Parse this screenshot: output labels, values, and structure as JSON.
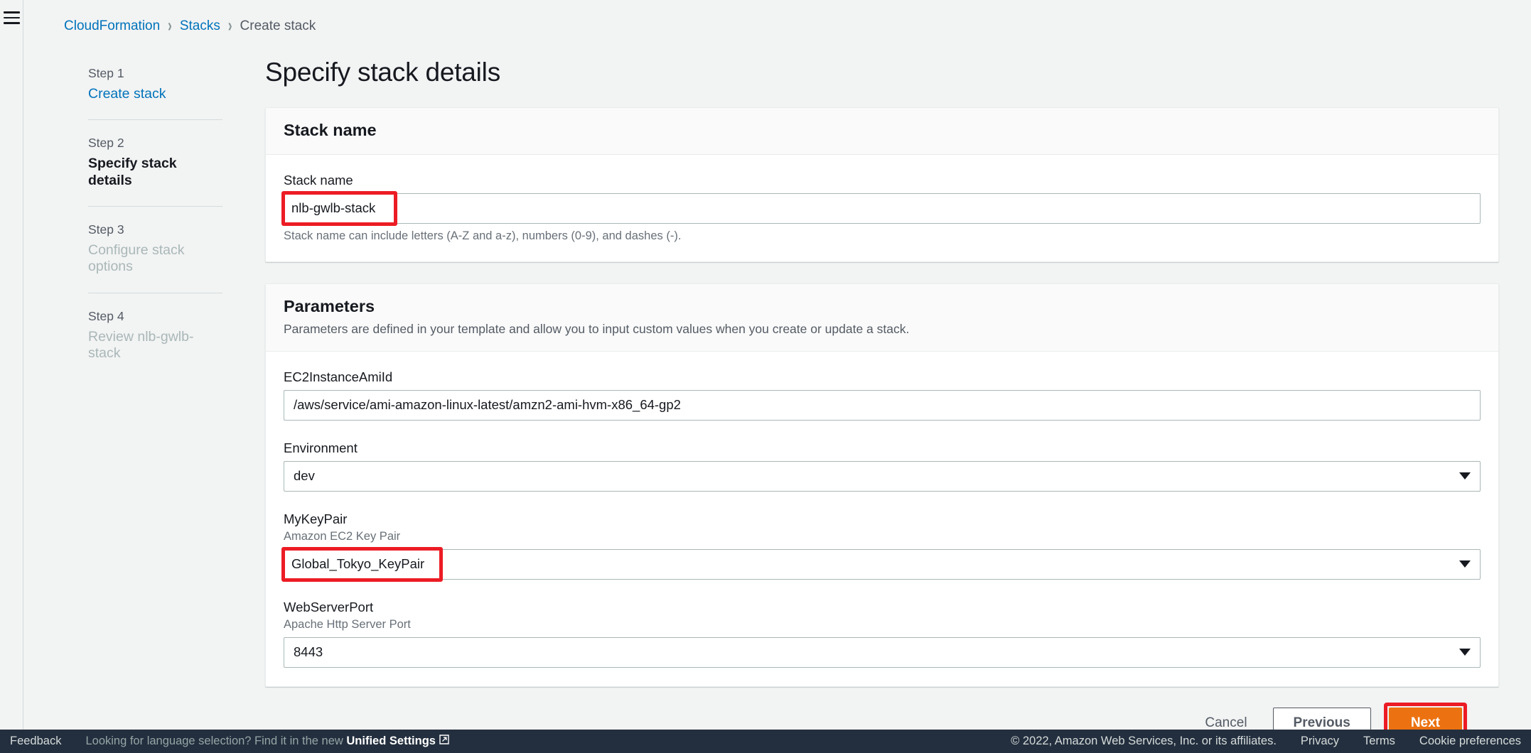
{
  "app": {
    "menu_icon": "hamburger-icon"
  },
  "breadcrumb": {
    "items": [
      {
        "label": "CloudFormation",
        "type": "link"
      },
      {
        "label": "Stacks",
        "type": "link"
      },
      {
        "label": "Create stack",
        "type": "current"
      }
    ],
    "separator": "›"
  },
  "steps": [
    {
      "num": "Step 1",
      "title": "Create stack",
      "state": "link"
    },
    {
      "num": "Step 2",
      "title": "Specify stack details",
      "state": "active"
    },
    {
      "num": "Step 3",
      "title": "Configure stack options",
      "state": "disabled"
    },
    {
      "num": "Step 4",
      "title": "Review nlb-gwlb-stack",
      "state": "disabled"
    }
  ],
  "page": {
    "title": "Specify stack details"
  },
  "stack_name_card": {
    "header": "Stack name",
    "field_label": "Stack name",
    "value": "nlb-gwlb-stack",
    "hint": "Stack name can include letters (A-Z and a-z), numbers (0-9), and dashes (-).",
    "highlighted": true
  },
  "parameters_card": {
    "header": "Parameters",
    "description": "Parameters are defined in your template and allow you to input custom values when you create or update a stack.",
    "fields": [
      {
        "label": "EC2InstanceAmiId",
        "sub": "",
        "value": "/aws/service/ami-amazon-linux-latest/amzn2-ami-hvm-x86_64-gp2",
        "control": "text",
        "highlighted": false
      },
      {
        "label": "Environment",
        "sub": "",
        "value": "dev",
        "control": "select",
        "highlighted": false
      },
      {
        "label": "MyKeyPair",
        "sub": "Amazon EC2 Key Pair",
        "value": "Global_Tokyo_KeyPair",
        "control": "select",
        "highlighted": true
      },
      {
        "label": "WebServerPort",
        "sub": "Apache Http Server Port",
        "value": "8443",
        "control": "select",
        "highlighted": false
      }
    ]
  },
  "actions": {
    "cancel": "Cancel",
    "previous": "Previous",
    "next": "Next",
    "next_highlighted": true
  },
  "footer": {
    "feedback": "Feedback",
    "language_prompt": "Looking for language selection? Find it in the new",
    "unified_settings": "Unified Settings",
    "external_icon": "external-link-icon",
    "copyright": "© 2022, Amazon Web Services, Inc. or its affiliates.",
    "privacy": "Privacy",
    "terms": "Terms",
    "cookie_preferences": "Cookie preferences"
  },
  "colors": {
    "accent_link": "#0073bb",
    "primary_button": "#ec7211",
    "highlight": "#ec1c24",
    "footer_bg": "#232f3e"
  }
}
